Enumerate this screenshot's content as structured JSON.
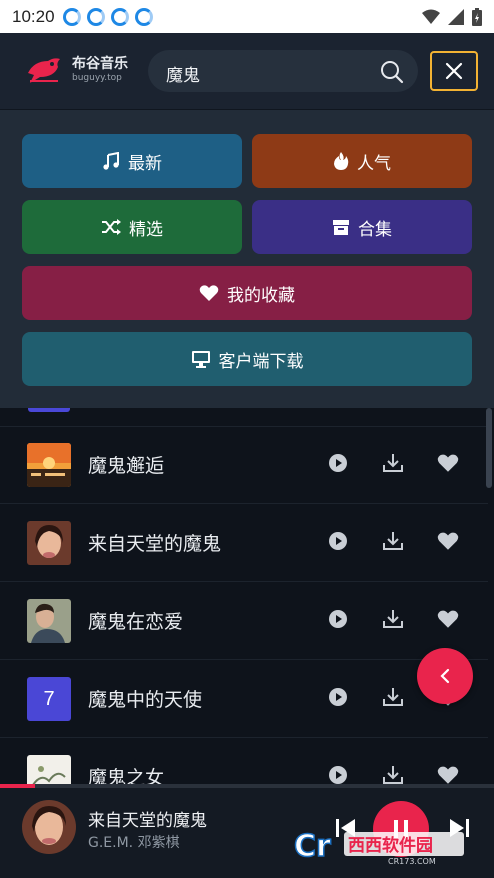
{
  "status_bar": {
    "time": "10:20"
  },
  "header": {
    "logo_cn": "布谷音乐",
    "logo_en": "buguyy.top",
    "search_value": "魔鬼"
  },
  "menu": {
    "latest": "最新",
    "popular": "人气",
    "selected": "精选",
    "collection": "合集",
    "favorites": "我的收藏",
    "client_download": "客户端下载"
  },
  "songs": [
    {
      "title": "魔鬼邂逅"
    },
    {
      "title": "来自天堂的魔鬼"
    },
    {
      "title": "魔鬼在恋爱"
    },
    {
      "title": "魔鬼中的天使",
      "badge": "7"
    },
    {
      "title": "魔鬼之女"
    }
  ],
  "player": {
    "title": "来自天堂的魔鬼",
    "artist": "G.E.M. 邓紫棋",
    "progress_fraction": 0.07
  },
  "colors": {
    "accent": "#e9244c",
    "latest": "#1e5f85",
    "popular": "#8e3a16",
    "selected": "#1e6b3a",
    "collection": "#3a2f86",
    "favorites": "#861f45",
    "client_download": "#205e6f"
  },
  "watermark": {
    "brand": "西西软件园",
    "domain": "CR173.COM"
  }
}
